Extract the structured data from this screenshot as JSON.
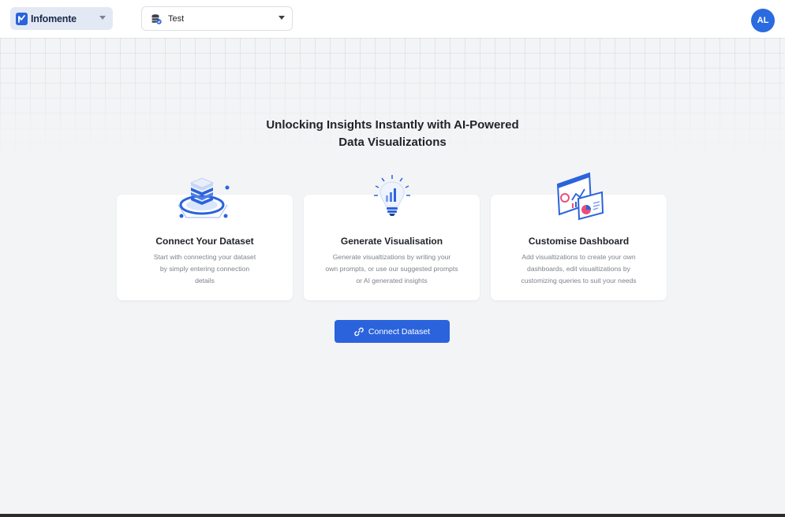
{
  "app": {
    "brand": "Infomente",
    "dataset_select": {
      "value": "Test"
    },
    "avatar_initials": "AL"
  },
  "hero": {
    "headline_line1": "Unlocking Insights Instantly with AI-Powered",
    "headline_line2": "Data Visualizations"
  },
  "cards": [
    {
      "title": "Connect Your Dataset",
      "desc_lines": [
        "Start with connecting your dataset",
        "by simply entering connection",
        "details"
      ],
      "icon": "database-stack-icon"
    },
    {
      "title": "Generate Visualisation",
      "desc_lines": [
        "Generate visualtizations by writing your",
        "own prompts, or use our suggested prompts",
        "or AI generated insights"
      ],
      "icon": "lightbulb-chart-icon"
    },
    {
      "title": "Customise Dashboard",
      "desc_lines": [
        "Add visualtizations to create your own",
        "dashboards, edit visualtizations by",
        "customizing queries to suit your needs"
      ],
      "icon": "dashboard-panels-icon"
    }
  ],
  "cta": {
    "label": "Connect Dataset",
    "icon": "link-icon"
  },
  "colors": {
    "accent": "#2a63dc",
    "background": "#f3f4f6",
    "card": "#ffffff"
  }
}
